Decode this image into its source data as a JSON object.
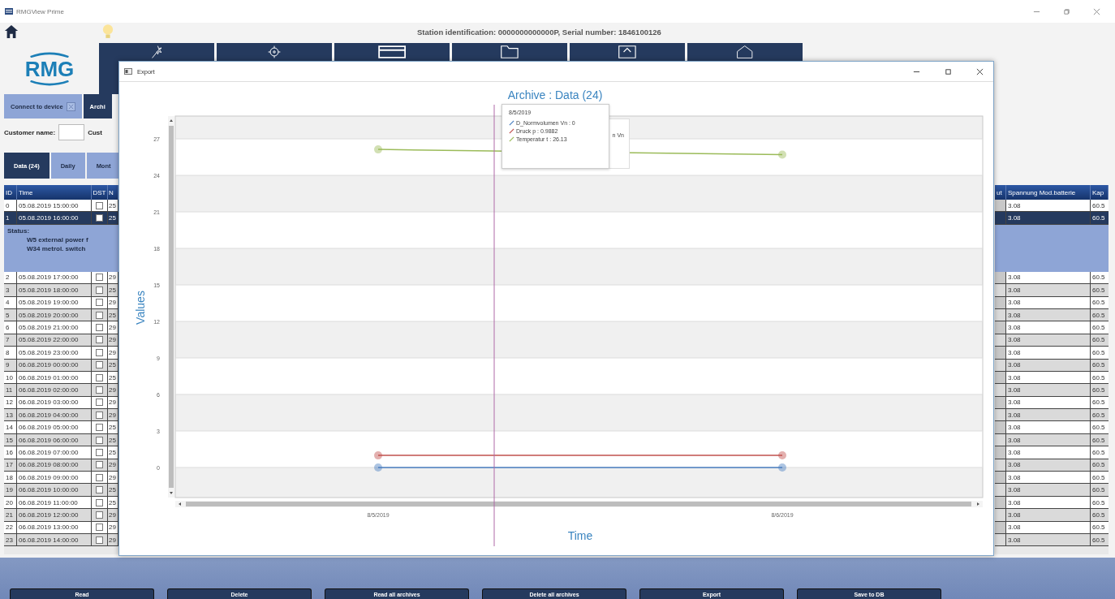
{
  "window": {
    "title": "RMGView Prime"
  },
  "header": {
    "station_text": "Station identification: 0000000000000P, Serial number: 1846100126",
    "logo_text": "RMG"
  },
  "nav_tiles": [
    {
      "kind": "wand"
    },
    {
      "kind": "gear"
    },
    {
      "kind": "device"
    },
    {
      "kind": "folder"
    },
    {
      "kind": "monitor"
    },
    {
      "kind": "house"
    }
  ],
  "top_tabs": [
    {
      "label": "Connect to device",
      "selected": false
    },
    {
      "label": "Archi",
      "selected": true
    }
  ],
  "customer": {
    "label": "Customer name:",
    "next_label": "Cust"
  },
  "archive_tabs": [
    {
      "label": "Data (24)",
      "selected": true
    },
    {
      "label": "Daily",
      "selected": false
    },
    {
      "label": "Mont",
      "selected": false
    }
  ],
  "table": {
    "columns": [
      "ID",
      "Time",
      "DST",
      "N",
      "ut",
      "Spannung Mod.batterie",
      "Kap"
    ],
    "status": {
      "label": "Status:",
      "lines": [
        "W5 external power f",
        "W34 metrol. switch"
      ]
    },
    "rows": [
      {
        "id": "0",
        "time": "05.08.2019 15:00:00",
        "dst": false,
        "n": "25",
        "spannung": "3.08",
        "kap": "60.5",
        "selected": false
      },
      {
        "id": "1",
        "time": "05.08.2019 16:00:00",
        "dst": false,
        "n": "25",
        "spannung": "3.08",
        "kap": "60.5",
        "selected": true
      },
      {
        "id": "2",
        "time": "05.08.2019 17:00:00",
        "dst": false,
        "n": "29",
        "spannung": "3.08",
        "kap": "60.5",
        "selected": false
      },
      {
        "id": "3",
        "time": "05.08.2019 18:00:00",
        "dst": false,
        "n": "25",
        "spannung": "3.08",
        "kap": "60.5",
        "selected": false
      },
      {
        "id": "4",
        "time": "05.08.2019 19:00:00",
        "dst": false,
        "n": "29",
        "spannung": "3.08",
        "kap": "60.5",
        "selected": false
      },
      {
        "id": "5",
        "time": "05.08.2019 20:00:00",
        "dst": false,
        "n": "25",
        "spannung": "3.08",
        "kap": "60.5",
        "selected": false
      },
      {
        "id": "6",
        "time": "05.08.2019 21:00:00",
        "dst": false,
        "n": "29",
        "spannung": "3.08",
        "kap": "60.5",
        "selected": false
      },
      {
        "id": "7",
        "time": "05.08.2019 22:00:00",
        "dst": false,
        "n": "29",
        "spannung": "3.08",
        "kap": "60.5",
        "selected": false
      },
      {
        "id": "8",
        "time": "05.08.2019 23:00:00",
        "dst": false,
        "n": "29",
        "spannung": "3.08",
        "kap": "60.5",
        "selected": false
      },
      {
        "id": "9",
        "time": "06.08.2019 00:00:00",
        "dst": false,
        "n": "25",
        "spannung": "3.08",
        "kap": "60.5",
        "selected": false
      },
      {
        "id": "10",
        "time": "06.08.2019 01:00:00",
        "dst": false,
        "n": "25",
        "spannung": "3.08",
        "kap": "60.5",
        "selected": false
      },
      {
        "id": "11",
        "time": "06.08.2019 02:00:00",
        "dst": false,
        "n": "29",
        "spannung": "3.08",
        "kap": "60.5",
        "selected": false
      },
      {
        "id": "12",
        "time": "06.08.2019 03:00:00",
        "dst": false,
        "n": "29",
        "spannung": "3.08",
        "kap": "60.5",
        "selected": false
      },
      {
        "id": "13",
        "time": "06.08.2019 04:00:00",
        "dst": false,
        "n": "29",
        "spannung": "3.08",
        "kap": "60.5",
        "selected": false
      },
      {
        "id": "14",
        "time": "06.08.2019 05:00:00",
        "dst": false,
        "n": "25",
        "spannung": "3.08",
        "kap": "60.5",
        "selected": false
      },
      {
        "id": "15",
        "time": "06.08.2019 06:00:00",
        "dst": false,
        "n": "25",
        "spannung": "3.08",
        "kap": "60.5",
        "selected": false
      },
      {
        "id": "16",
        "time": "06.08.2019 07:00:00",
        "dst": false,
        "n": "25",
        "spannung": "3.08",
        "kap": "60.5",
        "selected": false
      },
      {
        "id": "17",
        "time": "06.08.2019 08:00:00",
        "dst": false,
        "n": "29",
        "spannung": "3.08",
        "kap": "60.5",
        "selected": false
      },
      {
        "id": "18",
        "time": "06.08.2019 09:00:00",
        "dst": false,
        "n": "29",
        "spannung": "3.08",
        "kap": "60.5",
        "selected": false
      },
      {
        "id": "19",
        "time": "06.08.2019 10:00:00",
        "dst": false,
        "n": "25",
        "spannung": "3.08",
        "kap": "60.5",
        "selected": false
      },
      {
        "id": "20",
        "time": "06.08.2019 11:00:00",
        "dst": false,
        "n": "25",
        "spannung": "3.08",
        "kap": "60.5",
        "selected": false
      },
      {
        "id": "21",
        "time": "06.08.2019 12:00:00",
        "dst": false,
        "n": "29",
        "spannung": "3.08",
        "kap": "60.5",
        "selected": false
      },
      {
        "id": "22",
        "time": "06.08.2019 13:00:00",
        "dst": false,
        "n": "29",
        "spannung": "3.08",
        "kap": "60.5",
        "selected": false
      },
      {
        "id": "23",
        "time": "06.08.2019 14:00:00",
        "dst": false,
        "n": "29",
        "spannung": "3.08",
        "kap": "60.5",
        "selected": false
      }
    ]
  },
  "buttons": [
    "Read",
    "Delete",
    "Read all archives",
    "Delete all archives",
    "Export",
    "Save to DB"
  ],
  "export_window": {
    "title": "Export",
    "chart_data": {
      "type": "line",
      "title": "Archive : Data (24)",
      "xlabel": "Time",
      "ylabel": "Values",
      "categories": [
        "8/5/2019",
        "8/6/2019"
      ],
      "grid": true,
      "series": [
        {
          "name": "D_Normvolumen Vn",
          "color": "#4a7fc1",
          "marker": "circle",
          "values": [
            0,
            0
          ]
        },
        {
          "name": "Druck p",
          "color": "#c0504d",
          "marker": "circle",
          "values": [
            0.99,
            1.0
          ]
        },
        {
          "name": "Temperatur t",
          "color": "#9bbb59",
          "marker": "circle",
          "values": [
            26.13,
            25.7
          ]
        }
      ],
      "ylim": [
        -2.47,
        28.87
      ],
      "yticks": [
        0,
        3,
        6,
        9,
        12,
        15,
        18,
        21,
        24,
        27
      ]
    },
    "legend_fragment": "n Vn",
    "tooltip": {
      "date": "8/5/2019",
      "separator": " : ",
      "values": [
        "0",
        "0.9882",
        "26.13"
      ]
    }
  }
}
